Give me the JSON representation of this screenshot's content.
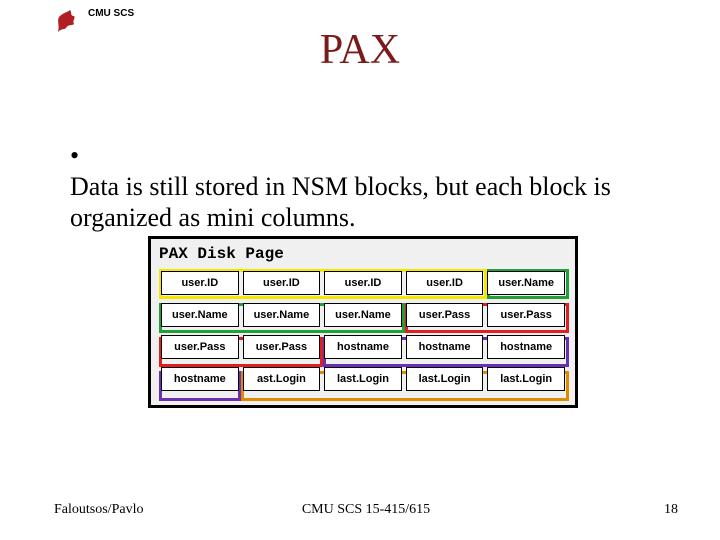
{
  "header": {
    "org": "CMU SCS"
  },
  "title": "PAX",
  "bullet": "Data is still stored in NSM blocks, but each block is organized as mini columns.",
  "pax": {
    "title": "PAX Disk Page",
    "rows": [
      [
        "user.ID",
        "user.ID",
        "user.ID",
        "user.ID",
        "user.Name"
      ],
      [
        "user.Name",
        "user.Name",
        "user.Name",
        "user.Pass",
        "user.Pass"
      ],
      [
        "user.Pass",
        "user.Pass",
        "hostname",
        "hostname",
        "hostname"
      ],
      [
        "hostname",
        "ast.Login",
        "last.Login",
        "last.Login",
        "last.Login"
      ]
    ]
  },
  "footer": {
    "left": "Faloutsos/Pavlo",
    "center": "CMU SCS 15-415/615",
    "right": "18"
  }
}
